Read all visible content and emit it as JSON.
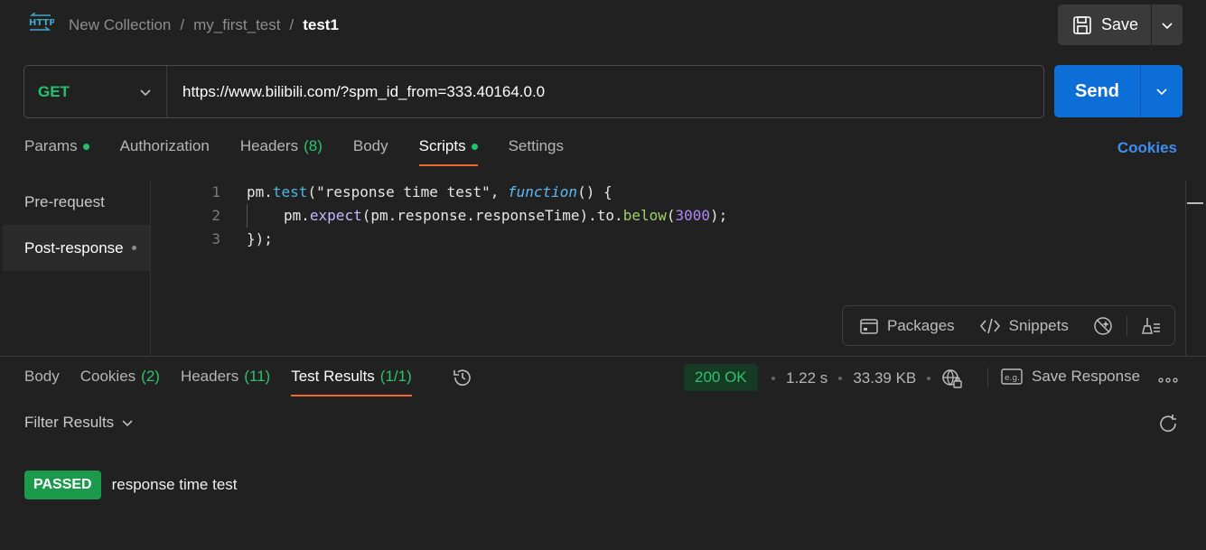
{
  "breadcrumb": {
    "collection": "New Collection",
    "folder": "my_first_test",
    "request": "test1",
    "separator": "/"
  },
  "header": {
    "save_label": "Save"
  },
  "request": {
    "method": "GET",
    "url": "https://www.bilibili.com/?spm_id_from=333.40164.0.0",
    "send_label": "Send"
  },
  "request_tabs": {
    "params": "Params",
    "authorization": "Authorization",
    "headers": "Headers",
    "headers_count": "(8)",
    "body": "Body",
    "scripts": "Scripts",
    "settings": "Settings",
    "cookies": "Cookies"
  },
  "scripts": {
    "pre_request": "Pre-request",
    "post_response": "Post-response",
    "line_numbers": [
      "1",
      "2",
      "3"
    ],
    "code": {
      "l1_obj": "pm.",
      "l1_method": "test",
      "l1_open": "(",
      "l1_str": "\"response time test\"",
      "l1_comma": ", ",
      "l1_fn": "function",
      "l1_rest": "() {",
      "l2_obj": "pm.",
      "l2_expect": "expect",
      "l2_mid": "(pm.response.responseTime).to.",
      "l2_below": "below",
      "l2_open": "(",
      "l2_num": "3000",
      "l2_close": ");",
      "l3": "});"
    },
    "toolbar": {
      "packages": "Packages",
      "snippets": "Snippets"
    }
  },
  "response_tabs": {
    "body": "Body",
    "cookies": "Cookies",
    "cookies_count": "(2)",
    "headers": "Headers",
    "headers_count": "(11)",
    "test_results": "Test Results",
    "test_results_count": "(1/1)"
  },
  "response_meta": {
    "status": "200 OK",
    "time": "1.22 s",
    "size": "33.39 KB",
    "save_response": "Save Response"
  },
  "test_results": {
    "filter_label": "Filter Results",
    "items": [
      {
        "status": "PASSED",
        "name": "response time test"
      }
    ]
  },
  "colors": {
    "accent_send": "#0d6ed8",
    "method_get": "#23c26a",
    "active_tab_underline": "#ef6b2d",
    "passed": "#1a9a4a",
    "cookies_link": "#3e8ef0"
  }
}
